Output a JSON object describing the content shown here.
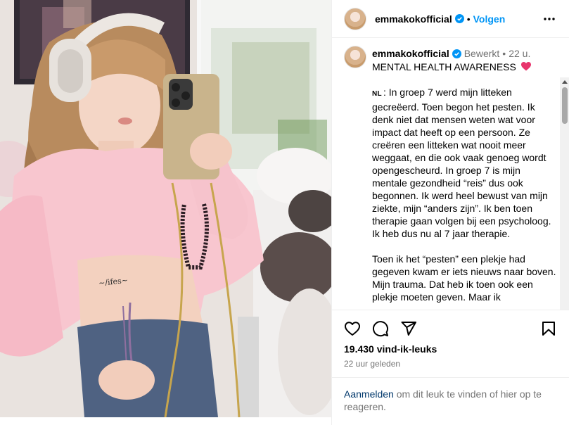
{
  "post": {
    "username": "emmakokofficial",
    "follow_label": "Volgen",
    "header_separator": "•",
    "caption_user": "emmakokofficial",
    "edited_label": "Bewerkt",
    "time_short": "22 u.",
    "caption_title": "MENTAL HEALTH AWARENESS",
    "flag_label": "NL",
    "paragraph1": ": In groep 7 werd mijn litteken gecreëerd. Toen begon het pesten. Ik denk niet dat mensen weten wat voor impact dat heeft op een persoon. Ze creëren een litteken wat nooit meer weggaat, en die ook vaak genoeg wordt opengescheurd. In groep 7 is mijn mentale gezondheid “reis” dus ook begonnen. Ik werd heel bewust van mijn ziekte, mijn “anders zijn”. Ik ben toen therapie gaan volgen bij een psycholoog. Ik heb dus nu al 7 jaar therapie.",
    "paragraph2": "Toen ik het “pesten” een plekje had gegeven kwam er iets nieuws naar boven. Mijn trauma. Dat heb ik toen ook een plekje moeten geven. Maar ik",
    "likes_text": "19.430 vind-ik-leuks",
    "time_ago": "22 uur geleden",
    "login_link": "Aanmelden",
    "login_rest": " om dit leuk te vinden of hier op te reageren."
  },
  "icons": {
    "verified": "verified-badge-icon",
    "more": "more-options-icon",
    "like": "heart-icon",
    "comment": "comment-icon",
    "share": "share-icon",
    "save": "bookmark-icon",
    "caption_emoji": "pink-heart-emoji"
  },
  "colors": {
    "accent": "#0095f6",
    "link": "#00376b",
    "muted": "#737373",
    "verified": "#0095f6",
    "emoji_heart": "#e8356d"
  }
}
